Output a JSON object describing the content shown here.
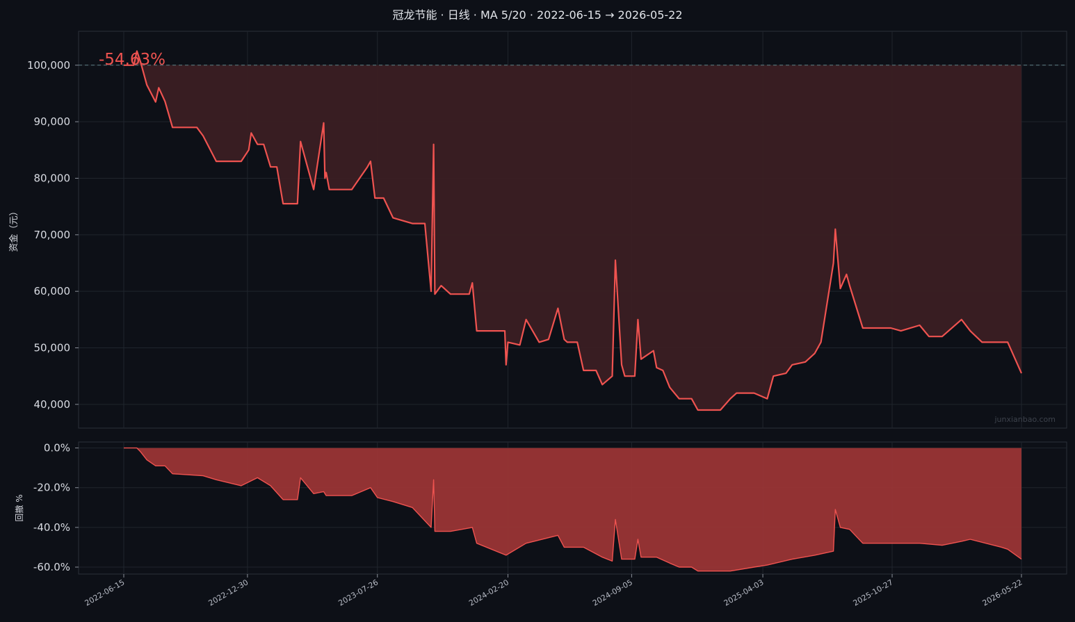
{
  "title": "冠龙节能 · 日线 · MA 5/20 · 2022-06-15 → 2026-05-22",
  "watermark": "junxianbao.com",
  "colors": {
    "background": "#0d1017",
    "line": "#ef5350",
    "equity_fill": "#3b1f23",
    "drawdown_fill": "#9a3535",
    "baseline": "#5f7f86"
  },
  "chart_data": [
    {
      "type": "area",
      "panel": "equity",
      "ylabel": "资金（元）",
      "ylim": [
        35800,
        106000
      ],
      "yticks": [
        40000,
        50000,
        60000,
        70000,
        80000,
        90000,
        100000
      ],
      "ytick_labels": [
        "40,000",
        "50,000",
        "60,000",
        "70,000",
        "80,000",
        "90,000",
        "100,000"
      ],
      "baseline": 100000,
      "annotation": "-54.63%",
      "x_start": "2022-06-15",
      "x_end": "2026-05-22",
      "xticks": [
        "2022-06-15",
        "2022-12-30",
        "2023-07-26",
        "2024-02-20",
        "2024-09-05",
        "2025-04-03",
        "2025-10-27",
        "2026-05-22"
      ],
      "x": [
        "2022-06-15",
        "2022-07-01",
        "2022-07-06",
        "2022-07-12",
        "2022-07-22",
        "2022-08-05",
        "2022-08-10",
        "2022-08-20",
        "2022-09-01",
        "2022-09-15",
        "2022-10-10",
        "2022-10-20",
        "2022-11-10",
        "2022-12-01",
        "2022-12-20",
        "2023-01-01",
        "2023-01-05",
        "2023-01-15",
        "2023-01-25",
        "2023-02-05",
        "2023-02-15",
        "2023-02-25",
        "2023-03-20",
        "2023-03-25",
        "2023-04-15",
        "2023-05-01",
        "2023-05-03",
        "2023-05-05",
        "2023-05-10",
        "2023-05-20",
        "2023-06-15",
        "2023-07-10",
        "2023-07-15",
        "2023-07-22",
        "2023-07-26",
        "2023-08-05",
        "2023-08-20",
        "2023-09-20",
        "2023-10-10",
        "2023-10-20",
        "2023-10-24",
        "2023-10-26",
        "2023-11-05",
        "2023-11-20",
        "2023-12-20",
        "2023-12-25",
        "2024-01-01",
        "2024-01-30",
        "2024-02-15",
        "2024-02-17",
        "2024-02-20",
        "2024-03-10",
        "2024-03-20",
        "2024-04-10",
        "2024-04-25",
        "2024-05-10",
        "2024-05-20",
        "2024-05-25",
        "2024-06-10",
        "2024-06-20",
        "2024-07-10",
        "2024-07-20",
        "2024-08-05",
        "2024-08-10",
        "2024-08-20",
        "2024-08-25",
        "2024-08-28",
        "2024-09-10",
        "2024-09-15",
        "2024-09-20",
        "2024-10-10",
        "2024-10-15",
        "2024-10-25",
        "2024-11-05",
        "2024-11-20",
        "2024-12-10",
        "2024-12-20",
        "2025-01-10",
        "2025-01-25",
        "2025-02-10",
        "2025-02-20",
        "2025-03-20",
        "2025-04-10",
        "2025-04-20",
        "2025-05-10",
        "2025-05-20",
        "2025-06-10",
        "2025-06-25",
        "2025-07-05",
        "2025-07-25",
        "2025-07-28",
        "2025-08-05",
        "2025-08-15",
        "2025-08-20",
        "2025-09-10",
        "2025-10-25",
        "2025-11-10",
        "2025-12-10",
        "2025-12-25",
        "2026-01-15",
        "2026-02-15",
        "2026-03-01",
        "2026-03-20",
        "2026-04-20",
        "2026-04-30",
        "2026-05-22"
      ],
      "values": [
        100000,
        100000,
        102500,
        100500,
        96500,
        93500,
        96000,
        93600,
        89000,
        89000,
        89000,
        87500,
        83000,
        83000,
        83000,
        85000,
        88000,
        86000,
        86000,
        82000,
        82000,
        75500,
        75500,
        86500,
        78000,
        89800,
        80000,
        81000,
        78000,
        78000,
        78000,
        82000,
        83000,
        76500,
        76500,
        76500,
        73000,
        72000,
        72000,
        60000,
        86000,
        59500,
        61000,
        59500,
        59500,
        61500,
        53000,
        53000,
        53000,
        47000,
        51000,
        50500,
        55000,
        51000,
        51500,
        57000,
        51500,
        51000,
        51000,
        46000,
        46000,
        43500,
        45000,
        65500,
        47000,
        45000,
        45000,
        45000,
        55000,
        48000,
        49500,
        46500,
        46000,
        43000,
        41000,
        41000,
        39000,
        39000,
        39000,
        41000,
        42000,
        42000,
        41000,
        45000,
        45500,
        47000,
        47500,
        49000,
        51000,
        65000,
        71000,
        60500,
        63000,
        61000,
        53500,
        53500,
        53000,
        54000,
        52000,
        52000,
        55000,
        53000,
        51000,
        51000,
        51000,
        45500
      ],
      "color": "#ef5350"
    },
    {
      "type": "area",
      "panel": "drawdown",
      "ylabel": "回撤 %",
      "ylim": [
        -63.5,
        3
      ],
      "yticks": [
        0,
        -20,
        -40,
        -60
      ],
      "ytick_labels": [
        "0.0%",
        "-20.0%",
        "-40.0%",
        "-60.0%"
      ],
      "x": [
        "2022-06-15",
        "2022-07-01",
        "2022-07-06",
        "2022-07-12",
        "2022-07-22",
        "2022-08-05",
        "2022-08-20",
        "2022-09-01",
        "2022-10-20",
        "2022-11-10",
        "2022-12-20",
        "2023-01-15",
        "2023-02-05",
        "2023-02-25",
        "2023-03-20",
        "2023-03-25",
        "2023-04-15",
        "2023-05-01",
        "2023-05-05",
        "2023-06-15",
        "2023-07-15",
        "2023-07-26",
        "2023-08-20",
        "2023-09-20",
        "2023-10-20",
        "2023-10-24",
        "2023-10-26",
        "2023-11-20",
        "2023-12-25",
        "2024-01-01",
        "2024-02-17",
        "2024-03-20",
        "2024-05-10",
        "2024-05-20",
        "2024-06-20",
        "2024-07-20",
        "2024-08-05",
        "2024-08-10",
        "2024-08-20",
        "2024-09-10",
        "2024-09-15",
        "2024-09-20",
        "2024-10-15",
        "2024-11-05",
        "2024-11-20",
        "2024-12-10",
        "2024-12-20",
        "2025-02-10",
        "2025-03-20",
        "2025-04-10",
        "2025-05-20",
        "2025-06-25",
        "2025-07-25",
        "2025-07-28",
        "2025-08-05",
        "2025-08-20",
        "2025-09-10",
        "2025-12-10",
        "2026-01-15",
        "2026-02-15",
        "2026-03-01",
        "2026-04-20",
        "2026-04-30",
        "2026-05-22"
      ],
      "values": [
        0,
        0,
        0,
        -2,
        -6,
        -9,
        -9,
        -13,
        -14,
        -16,
        -19,
        -15,
        -19,
        -26,
        -26,
        -15,
        -23,
        -22,
        -24,
        -24,
        -20,
        -25,
        -27,
        -30,
        -40,
        -16,
        -42,
        -42,
        -40,
        -48,
        -54,
        -48,
        -44,
        -50,
        -50,
        -55,
        -57,
        -36,
        -56,
        -56,
        -46,
        -55,
        -55,
        -58,
        -60,
        -60,
        -62,
        -62,
        -60,
        -59,
        -56,
        -54,
        -52,
        -31,
        -40,
        -41,
        -48,
        -48,
        -49,
        -47,
        -46,
        -50,
        -51,
        -56
      ],
      "color": "#ef5350"
    }
  ]
}
